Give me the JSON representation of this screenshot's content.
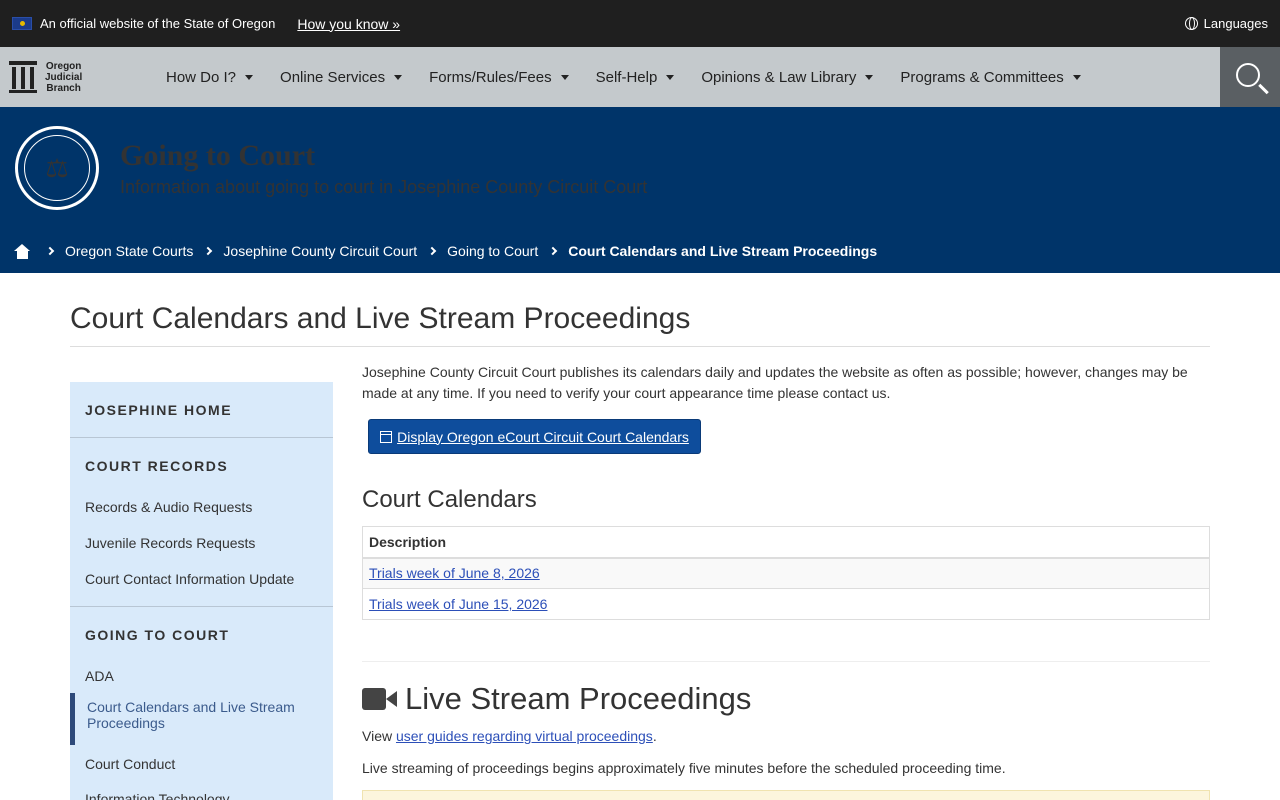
{
  "banner": {
    "official_text": "An official website of the State of Oregon",
    "how_you_know": "How you know »",
    "languages": "Languages"
  },
  "nav": {
    "logo_lines": [
      "Oregon",
      "Judicial",
      "Branch"
    ],
    "items": [
      {
        "label": "How Do I?"
      },
      {
        "label": "Online Services"
      },
      {
        "label": "Forms/Rules/Fees"
      },
      {
        "label": "Self-Help"
      },
      {
        "label": "Opinions & Law Library"
      },
      {
        "label": "Programs & Committees"
      }
    ]
  },
  "hero": {
    "title": "Going to Court",
    "subtitle": "Information about going to court in Josephine County Circuit Court"
  },
  "breadcrumb": [
    {
      "label": "Oregon State Courts"
    },
    {
      "label": "Josephine County Circuit Court"
    },
    {
      "label": "Going to Court"
    },
    {
      "label": "Court Calendars and Live Stream Proceedings"
    }
  ],
  "page": {
    "title": "Court Calendars and Live Stream Proceedings"
  },
  "sidebar": {
    "home": "JOSEPHINE HOME",
    "section_records": "COURT RECORDS",
    "records_links": [
      "Records & Audio Requests",
      "Juvenile Records Requests",
      "Court Contact Information Update"
    ],
    "section_court": "GOING TO COURT",
    "court_links": [
      "ADA",
      "Court Calendars and Live Stream Proceedings",
      "Court Conduct",
      "Information Technology"
    ]
  },
  "main": {
    "intro": "Josephine County Circuit Court publishes its calendars daily and updates the website as often as possible; however, changes may be made at any time. If you need to verify your court appearance time please contact us.",
    "ecourt_button": "Display Oregon eCourt Circuit Court Calendars",
    "court_calendars_heading": "Court Calendars",
    "table_header": "Description",
    "calendar_rows": [
      "Trials week of June 8, 2026",
      "Trials week of June 15, 2026"
    ],
    "live_stream_heading": "Live Stream Proceedings",
    "view_prefix": "View ",
    "view_link": "user guides regarding virtual proceedings",
    "view_suffix": ".",
    "live_stream_text": "Live streaming of proceedings begins approximately five minutes before the scheduled proceeding time."
  }
}
